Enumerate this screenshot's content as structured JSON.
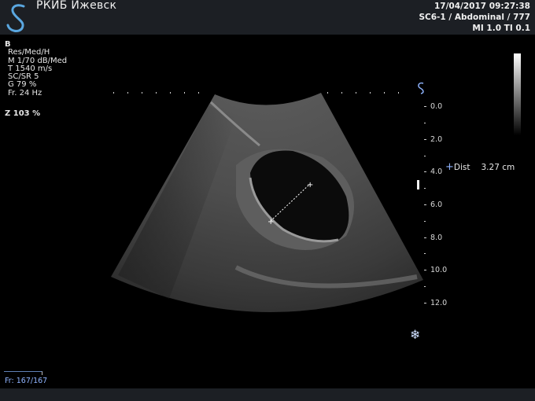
{
  "header": {
    "institution": "РКИБ Ижевск",
    "datetime": "17/04/2017 09:27:38",
    "probe_info": "SC6-1 / Abdominal / 777",
    "indices": "MI 1.0  TI 0.1"
  },
  "logo_icon": "ultrasound-brand-s-icon",
  "imaging_params": {
    "mode": "B",
    "lines": [
      "Res/Med/H",
      "M 1/70 dB/Med",
      "T 1540 m/s",
      "SC/SR 5",
      "G 79 %",
      "Fr. 24 Hz"
    ],
    "zoom": "Z  103  %"
  },
  "depth_scale": {
    "unit": "cm",
    "labels": [
      "0.0",
      "2.0",
      "4.0",
      "6.0",
      "8.0",
      "10.0",
      "12.0"
    ]
  },
  "measurement": {
    "label": "Dist",
    "value": "3.27",
    "unit": "cm"
  },
  "freeze_icon": "snowflake-icon",
  "cine": {
    "frame_text": "Fr: 167/167"
  },
  "colors": {
    "bar_bg": "#1c1f24",
    "accent_blue": "#8fb4ff",
    "logo_blue": "#5aa7e0"
  }
}
